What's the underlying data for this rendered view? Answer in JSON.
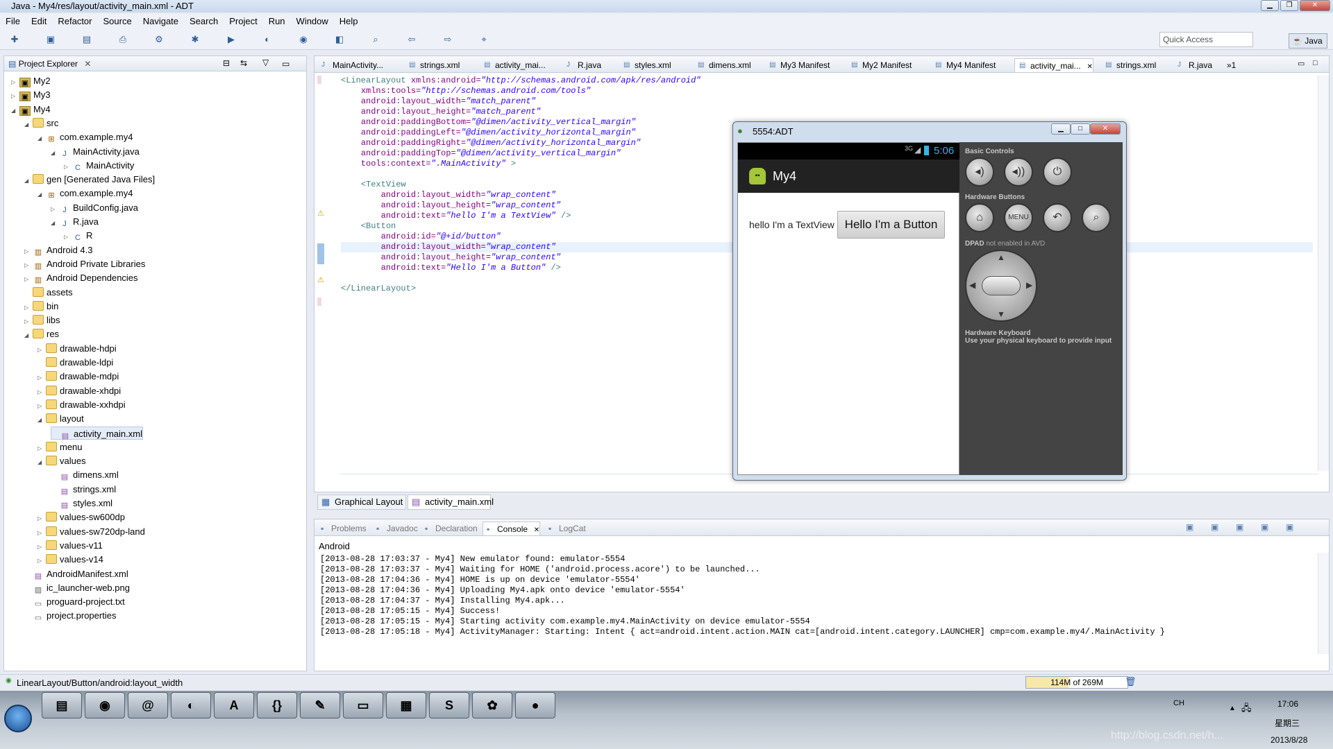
{
  "window": {
    "title": "Java - My4/res/layout/activity_main.xml - ADT"
  },
  "menu": [
    "File",
    "Edit",
    "Refactor",
    "Source",
    "Navigate",
    "Search",
    "Project",
    "Run",
    "Window",
    "Help"
  ],
  "toolbar": {
    "quick_access": "Quick Access",
    "perspective": "Java"
  },
  "explorer": {
    "title": "Project Explorer",
    "items": [
      {
        "label": "My2",
        "depth": 0,
        "icon": "project",
        "tw": "▷"
      },
      {
        "label": "My3",
        "depth": 0,
        "icon": "project",
        "tw": "▷"
      },
      {
        "label": "My4",
        "depth": 0,
        "icon": "project",
        "tw": "◢"
      },
      {
        "label": "src",
        "depth": 1,
        "icon": "folder",
        "tw": "◢"
      },
      {
        "label": "com.example.my4",
        "depth": 2,
        "icon": "package",
        "tw": "◢"
      },
      {
        "label": "MainActivity.java",
        "depth": 3,
        "icon": "java",
        "tw": "◢"
      },
      {
        "label": "MainActivity",
        "depth": 4,
        "icon": "class",
        "tw": "▷"
      },
      {
        "label": "gen [Generated Java Files]",
        "depth": 1,
        "icon": "folder",
        "tw": "◢"
      },
      {
        "label": "com.example.my4",
        "depth": 2,
        "icon": "package",
        "tw": "◢"
      },
      {
        "label": "BuildConfig.java",
        "depth": 3,
        "icon": "java",
        "tw": "▷"
      },
      {
        "label": "R.java",
        "depth": 3,
        "icon": "java",
        "tw": "◢"
      },
      {
        "label": "R",
        "depth": 4,
        "icon": "class",
        "tw": "▷"
      },
      {
        "label": "Android 4.3",
        "depth": 1,
        "icon": "lib",
        "tw": "▷"
      },
      {
        "label": "Android Private Libraries",
        "depth": 1,
        "icon": "lib",
        "tw": "▷"
      },
      {
        "label": "Android Dependencies",
        "depth": 1,
        "icon": "lib",
        "tw": "▷"
      },
      {
        "label": "assets",
        "depth": 1,
        "icon": "folder",
        "tw": ""
      },
      {
        "label": "bin",
        "depth": 1,
        "icon": "folder",
        "tw": "▷"
      },
      {
        "label": "libs",
        "depth": 1,
        "icon": "folder",
        "tw": "▷"
      },
      {
        "label": "res",
        "depth": 1,
        "icon": "folder",
        "tw": "◢"
      },
      {
        "label": "drawable-hdpi",
        "depth": 2,
        "icon": "folder",
        "tw": "▷"
      },
      {
        "label": "drawable-ldpi",
        "depth": 2,
        "icon": "folder",
        "tw": ""
      },
      {
        "label": "drawable-mdpi",
        "depth": 2,
        "icon": "folder",
        "tw": "▷"
      },
      {
        "label": "drawable-xhdpi",
        "depth": 2,
        "icon": "folder",
        "tw": "▷"
      },
      {
        "label": "drawable-xxhdpi",
        "depth": 2,
        "icon": "folder",
        "tw": "▷"
      },
      {
        "label": "layout",
        "depth": 2,
        "icon": "folder",
        "tw": "◢"
      },
      {
        "label": "activity_main.xml",
        "depth": 3,
        "icon": "xml",
        "tw": "",
        "selected": true
      },
      {
        "label": "menu",
        "depth": 2,
        "icon": "folder",
        "tw": "▷"
      },
      {
        "label": "values",
        "depth": 2,
        "icon": "folder",
        "tw": "◢"
      },
      {
        "label": "dimens.xml",
        "depth": 3,
        "icon": "xml",
        "tw": ""
      },
      {
        "label": "strings.xml",
        "depth": 3,
        "icon": "xml",
        "tw": ""
      },
      {
        "label": "styles.xml",
        "depth": 3,
        "icon": "xml",
        "tw": ""
      },
      {
        "label": "values-sw600dp",
        "depth": 2,
        "icon": "folder",
        "tw": "▷"
      },
      {
        "label": "values-sw720dp-land",
        "depth": 2,
        "icon": "folder",
        "tw": "▷"
      },
      {
        "label": "values-v11",
        "depth": 2,
        "icon": "folder",
        "tw": "▷"
      },
      {
        "label": "values-v14",
        "depth": 2,
        "icon": "folder",
        "tw": "▷"
      },
      {
        "label": "AndroidManifest.xml",
        "depth": 1,
        "icon": "xml",
        "tw": ""
      },
      {
        "label": "ic_launcher-web.png",
        "depth": 1,
        "icon": "image",
        "tw": ""
      },
      {
        "label": "proguard-project.txt",
        "depth": 1,
        "icon": "file",
        "tw": ""
      },
      {
        "label": "project.properties",
        "depth": 1,
        "icon": "file",
        "tw": ""
      }
    ]
  },
  "editor_tabs": [
    "MainActivity...",
    "strings.xml",
    "activity_mai...",
    "R.java",
    "styles.xml",
    "dimens.xml",
    "My3 Manifest",
    "My2 Manifest",
    "My4 Manifest",
    "activity_mai...",
    "strings.xml",
    "R.java",
    "»1"
  ],
  "code": [
    [
      [
        "tag",
        "<LinearLayout "
      ],
      [
        "attr",
        "xmlns:android="
      ],
      [
        "val",
        "\"http://schemas.android.com/apk/res/android\""
      ]
    ],
    [
      [
        "plain",
        "    "
      ],
      [
        "attr",
        "xmlns:tools="
      ],
      [
        "val",
        "\"http://schemas.android.com/tools\""
      ]
    ],
    [
      [
        "plain",
        "    "
      ],
      [
        "attr",
        "android:layout_width="
      ],
      [
        "val",
        "\"match_parent\""
      ]
    ],
    [
      [
        "plain",
        "    "
      ],
      [
        "attr",
        "android:layout_height="
      ],
      [
        "val",
        "\"match_parent\""
      ]
    ],
    [
      [
        "plain",
        "    "
      ],
      [
        "attr",
        "android:paddingBottom="
      ],
      [
        "val",
        "\"@dimen/activity_vertical_margin\""
      ]
    ],
    [
      [
        "plain",
        "    "
      ],
      [
        "attr",
        "android:paddingLeft="
      ],
      [
        "val",
        "\"@dimen/activity_horizontal_margin\""
      ]
    ],
    [
      [
        "plain",
        "    "
      ],
      [
        "attr",
        "android:paddingRight="
      ],
      [
        "val",
        "\"@dimen/activity_horizontal_margin\""
      ]
    ],
    [
      [
        "plain",
        "    "
      ],
      [
        "attr",
        "android:paddingTop="
      ],
      [
        "val",
        "\"@dimen/activity_vertical_margin\""
      ]
    ],
    [
      [
        "plain",
        "    "
      ],
      [
        "attr",
        "tools:context="
      ],
      [
        "val",
        "\".MainActivity\""
      ],
      [
        "tag",
        " >"
      ]
    ],
    [
      [
        "plain",
        ""
      ]
    ],
    [
      [
        "plain",
        "    "
      ],
      [
        "tag",
        "<TextView"
      ]
    ],
    [
      [
        "plain",
        "        "
      ],
      [
        "attr",
        "android:layout_width="
      ],
      [
        "val",
        "\"wrap_content\""
      ]
    ],
    [
      [
        "plain",
        "        "
      ],
      [
        "attr",
        "android:layout_height="
      ],
      [
        "val",
        "\"wrap_content\""
      ]
    ],
    [
      [
        "plain",
        "        "
      ],
      [
        "attr",
        "android:text="
      ],
      [
        "val",
        "\"hello I'm a TextView\""
      ],
      [
        "tag",
        " />"
      ]
    ],
    [
      [
        "plain",
        "    "
      ],
      [
        "tag",
        "<Button"
      ]
    ],
    [
      [
        "plain",
        "        "
      ],
      [
        "attr",
        "android:id="
      ],
      [
        "val",
        "\"@+id/button\""
      ]
    ],
    [
      [
        "plain",
        "        "
      ],
      [
        "attr",
        "android:layout_width="
      ],
      [
        "val",
        "\"wrap_content\""
      ]
    ],
    [
      [
        "plain",
        "        "
      ],
      [
        "attr",
        "android:layout_height="
      ],
      [
        "val",
        "\"wrap_content\""
      ]
    ],
    [
      [
        "plain",
        "        "
      ],
      [
        "attr",
        "android:text="
      ],
      [
        "val",
        "\"Hello I'm a Button\""
      ],
      [
        "tag",
        " />"
      ]
    ],
    [
      [
        "plain",
        ""
      ]
    ],
    [
      [
        "tag",
        "</LinearLayout>"
      ]
    ]
  ],
  "editor_bottom_tabs": {
    "graphical": "Graphical Layout",
    "xml": "activity_main.xml"
  },
  "emulator": {
    "title": "5554:ADT",
    "time": "5:06",
    "signal": "3G",
    "app_title": "My4",
    "textview": "hello I'm a TextView",
    "button": "Hello I'm a Button",
    "basic_controls": "Basic Controls",
    "hardware_buttons": "Hardware Buttons",
    "menu_button": "MENU",
    "dpad_label": "DPAD",
    "dpad_note": "not enabled in AVD",
    "keyboard_title": "Hardware Keyboard",
    "keyboard_note": "Use your physical keyboard to provide input"
  },
  "console": {
    "tabs": [
      "Problems",
      "Javadoc",
      "Declaration",
      "Console",
      "LogCat"
    ],
    "label": "Android",
    "lines": [
      "[2013-08-28 17:03:37 - My4] New emulator found: emulator-5554",
      "[2013-08-28 17:03:37 - My4] Waiting for HOME ('android.process.acore') to be launched...",
      "[2013-08-28 17:04:36 - My4] HOME is up on device 'emulator-5554'",
      "[2013-08-28 17:04:36 - My4] Uploading My4.apk onto device 'emulator-5554'",
      "[2013-08-28 17:04:37 - My4] Installing My4.apk...",
      "[2013-08-28 17:05:15 - My4] Success!",
      "[2013-08-28 17:05:15 - My4] Starting activity com.example.my4.MainActivity on device emulator-5554",
      "[2013-08-28 17:05:18 - My4] ActivityManager: Starting: Intent { act=android.intent.action.MAIN cat=[android.intent.category.LAUNCHER] cmp=com.example.my4/.MainActivity }"
    ]
  },
  "status": {
    "path": "LinearLayout/Button/android:layout_width",
    "heap": "114M of 269M",
    "heap_used_fraction": 0.42
  },
  "taskbar": {
    "apps": [
      "explorer",
      "chrome",
      "spiral",
      "eclipse",
      "pdf",
      "braces",
      "tool",
      "terminal",
      "package",
      "sublime",
      "paint",
      "android"
    ],
    "time": "17:06",
    "weekday": "星期三",
    "date": "2013/8/28",
    "lang": "CH",
    "watermark": "http://blog.csdn.net/h..."
  }
}
